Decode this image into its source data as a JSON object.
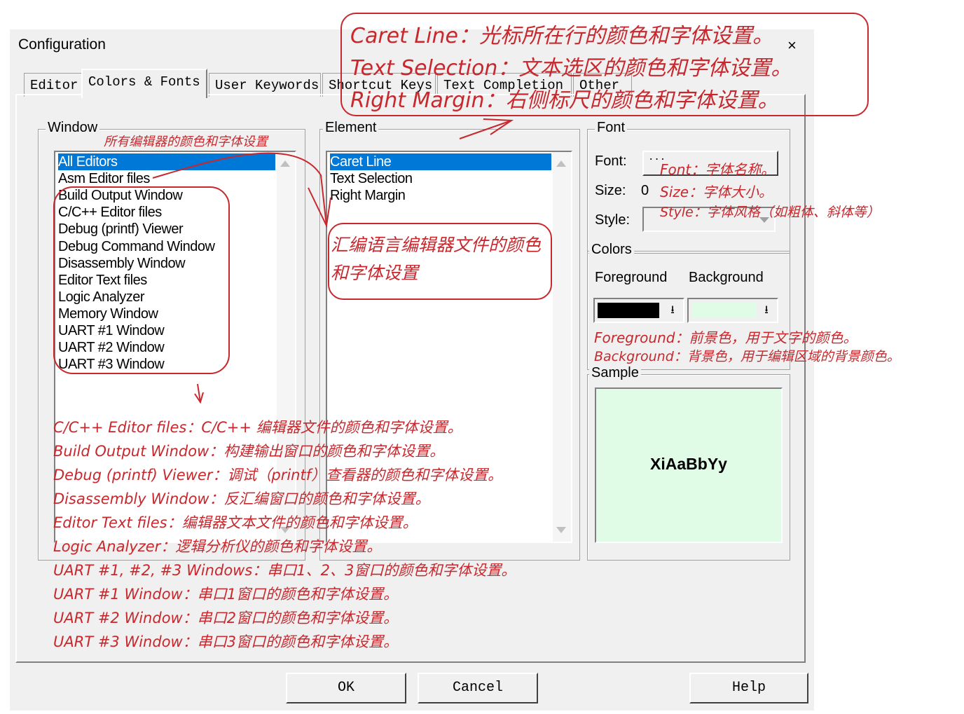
{
  "window": {
    "title": "Configuration",
    "close_glyph": "×"
  },
  "tabs": [
    "Editor",
    "Colors & Fonts",
    "User Keywords",
    "Shortcut Keys",
    "Text Completion",
    "Other"
  ],
  "window_group": {
    "label": "Window",
    "items": [
      "All Editors",
      "Asm Editor files",
      "Build Output Window",
      "C/C++ Editor files",
      "Debug (printf) Viewer",
      "Debug Command Window",
      "Disassembly Window",
      "Editor Text files",
      "Logic Analyzer",
      "Memory Window",
      "UART #1 Window",
      "UART #2 Window",
      "UART #3 Window"
    ],
    "selected": "All Editors"
  },
  "element_group": {
    "label": "Element",
    "items": [
      "Caret Line",
      "Text Selection",
      "Right Margin"
    ],
    "selected": "Caret Line"
  },
  "font_group": {
    "label": "Font",
    "font_label": "Font:",
    "font_button": "...",
    "size_label": "Size:",
    "size_value": "0",
    "style_label": "Style:"
  },
  "colors_group": {
    "label": "Colors",
    "foreground_label": "Foreground",
    "background_label": "Background",
    "foreground_color": "#000000",
    "background_color": "#e0fce6"
  },
  "sample_group": {
    "label": "Sample",
    "text": "XiAaBbYy"
  },
  "buttons": {
    "ok": "OK",
    "cancel": "Cancel",
    "help": "Help"
  },
  "annotations": {
    "caret_line": "Caret Line：光标所在行的颜色和字体设置。",
    "text_selection": "Text Selection：文本选区的颜色和字体设置。",
    "right_margin": "Right Margin：右侧标尺的颜色和字体设置。",
    "all_editors": "所有编辑器的颜色和字体设置",
    "asm_editor": "汇编语言编辑器文件的颜色和字体设置",
    "font": "Font：字体名称。",
    "size": "Size：字体大小。",
    "style": "Style：字体风格（如粗体、斜体等）",
    "foreground": "Foreground：前景色，用于文字的颜色。",
    "background": "Background：背景色，用于编辑区域的背景颜色。",
    "notes": [
      "C/C++ Editor files：C/C++ 编辑器文件的颜色和字体设置。",
      "Build Output Window：构建输出窗口的颜色和字体设置。",
      "Debug (printf) Viewer：调试（printf）查看器的颜色和字体设置。",
      "Disassembly Window：反汇编窗口的颜色和字体设置。",
      "Editor Text files：编辑器文本文件的颜色和字体设置。",
      "Logic Analyzer：逻辑分析仪的颜色和字体设置。",
      "UART #1, #2, #3 Windows：串口1、2、3窗口的颜色和字体设置。",
      "UART #1 Window：串口1窗口的颜色和字体设置。",
      "UART #2 Window：串口2窗口的颜色和字体设置。",
      "UART #3 Window：串口3窗口的颜色和字体设置。"
    ]
  }
}
